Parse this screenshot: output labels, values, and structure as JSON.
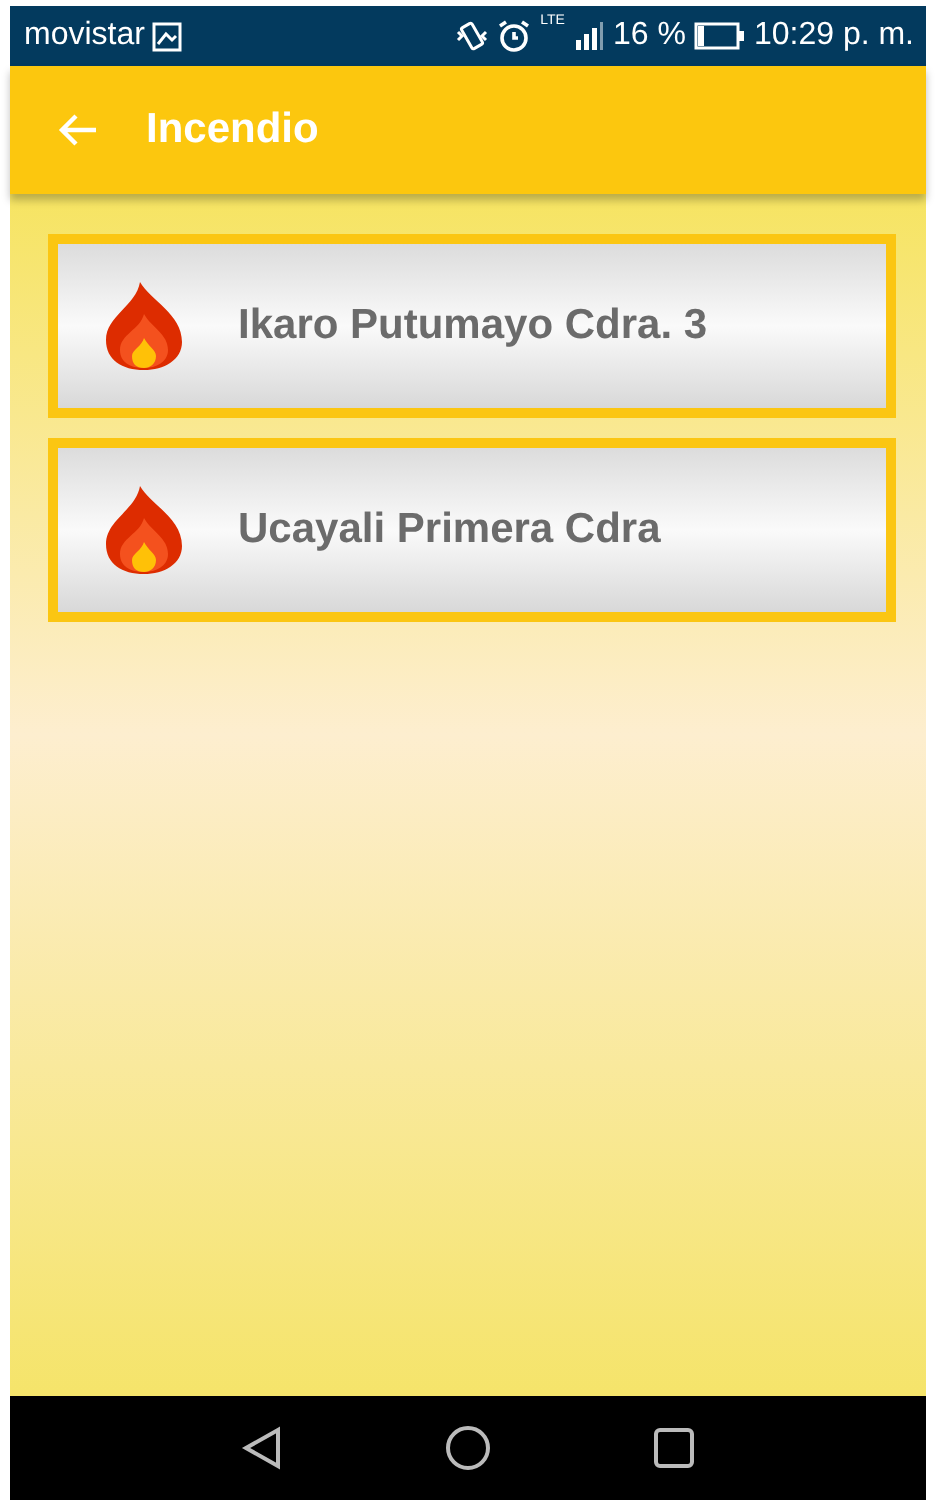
{
  "status_bar": {
    "carrier": "movistar",
    "network": "LTE",
    "battery": "16 %",
    "time": "10:29 p. m."
  },
  "app_bar": {
    "title": "Incendio"
  },
  "items": [
    {
      "label": "Ikaro Putumayo Cdra. 3"
    },
    {
      "label": "Ucayali Primera Cdra"
    }
  ]
}
